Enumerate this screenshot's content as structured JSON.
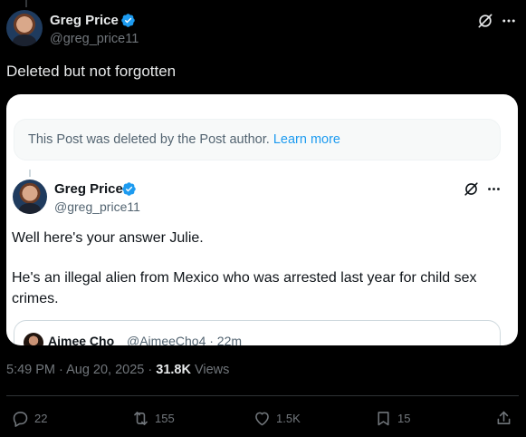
{
  "post": {
    "author_name": "Greg Price",
    "author_handle": "@greg_price11",
    "text": "Deleted but not forgotten",
    "timestamp": "5:49 PM · Aug 20, 2025",
    "dot": " · ",
    "views_count": "31.8K",
    "views_label": " Views"
  },
  "quote": {
    "deleted_notice": "This Post was deleted by the Post author.",
    "learn_more": "Learn more",
    "author_name": "Greg Price",
    "author_handle": "@greg_price11",
    "text_line1": "Well here's your answer Julie.",
    "text_line2": "He's an illegal alien from Mexico who was arrested last year for child sex",
    "text_line3": "crimes.",
    "nested": {
      "author_name": "Aimee Cho",
      "meta": "@AimeeCho4 · 22m"
    }
  },
  "actions": {
    "replies": "22",
    "reposts": "155",
    "likes": "1.5K",
    "bookmarks": "15"
  },
  "colors": {
    "background": "#000000",
    "verified": "#1d9bf0",
    "link": "#1d9bf0",
    "muted": "#71767b"
  },
  "icons": [
    "verified-badge-icon",
    "grok-icon",
    "more-icon",
    "reply-icon",
    "repost-icon",
    "like-icon",
    "bookmark-icon",
    "share-icon"
  ]
}
